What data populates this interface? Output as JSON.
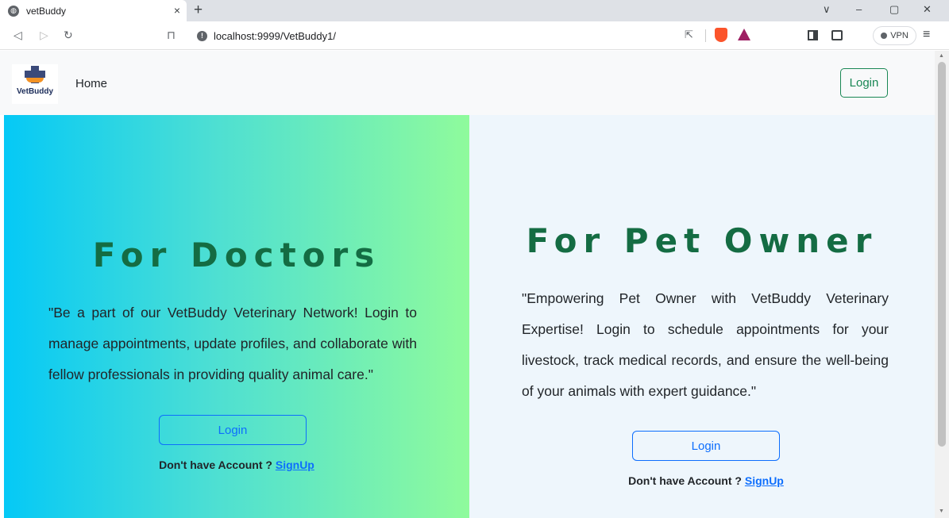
{
  "browser": {
    "tab_title": "vetBuddy",
    "tab_close": "×",
    "new_tab": "+",
    "url": "localhost:9999/VetBuddy1/",
    "vpn_label": "VPN",
    "window_controls": [
      "∨",
      "–",
      "▢",
      "✕"
    ]
  },
  "navbar": {
    "logo_text": "VetBuddy",
    "home_link": "Home",
    "login_button": "Login"
  },
  "doctors": {
    "heading": "For Doctors",
    "description": "\"Be a part of our VetBuddy Veterinary Network! Login to manage appointments, update profiles, and collaborate with fellow professionals in providing quality animal care.\"",
    "login_button": "Login",
    "no_account_text": "Don't have Account ?",
    "signup_link": "SignUp",
    "gradient_colors": [
      "#05c9f6",
      "#8ffb9c"
    ]
  },
  "pet_owner": {
    "heading": "For Pet Owner",
    "description": "\"Empowering Pet Owner with VetBuddy Veterinary Expertise! Login to schedule appointments for your livestock, track medical records, and ensure the well-being of your animals with expert guidance.\"",
    "login_button": "Login",
    "no_account_text": "Don't have Account ?",
    "signup_link": "SignUp"
  },
  "colors": {
    "heading_green": "#146c43",
    "link_blue": "#0d6efd",
    "nav_login_green": "#198754"
  }
}
